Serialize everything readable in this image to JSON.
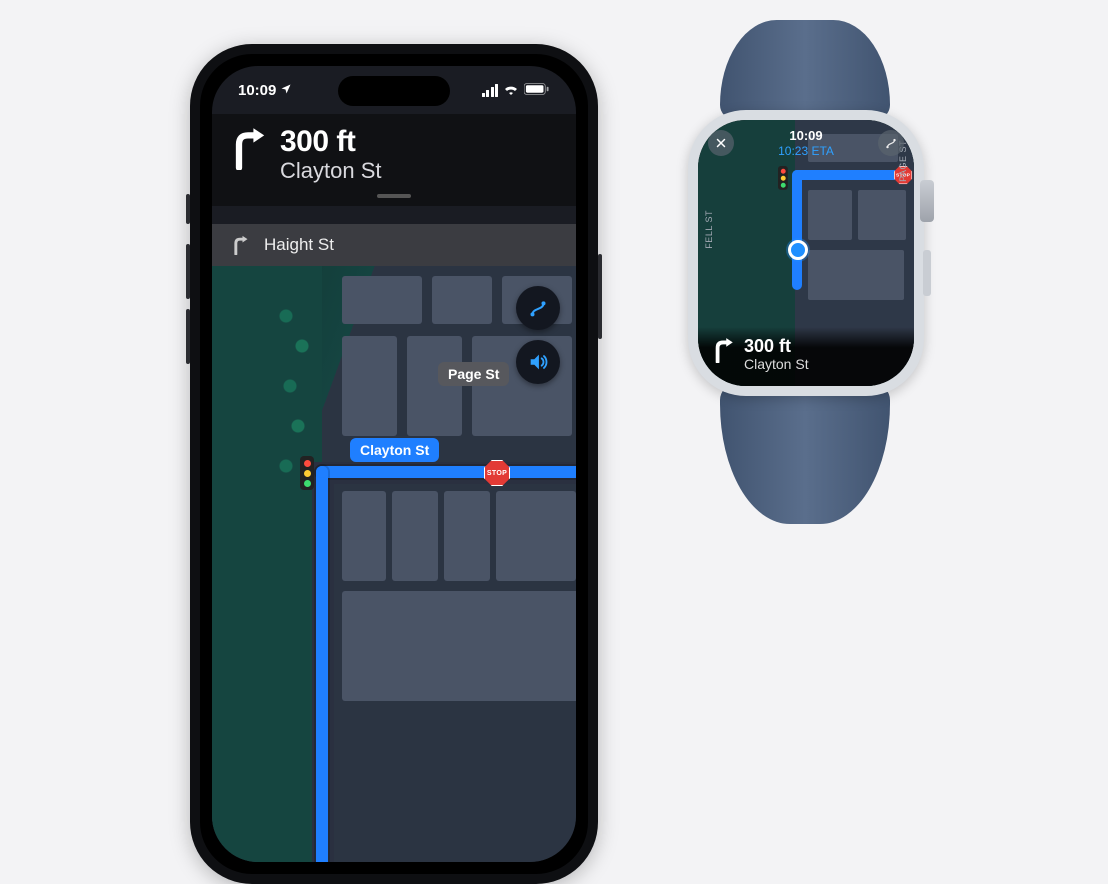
{
  "iphone": {
    "status": {
      "time": "10:09"
    },
    "nav": {
      "distance": "300 ft",
      "street": "Clayton St",
      "next_street": "Haight St"
    },
    "map_labels": {
      "clayton": "Clayton St",
      "page": "Page St",
      "stop": "STOP"
    }
  },
  "watch": {
    "time": "10:09",
    "eta": "10:23 ETA",
    "nav": {
      "distance": "300 ft",
      "street": "Clayton St"
    },
    "labels": {
      "fell": "FELL ST",
      "page": "PAGE ST",
      "stop": "STOP"
    }
  }
}
